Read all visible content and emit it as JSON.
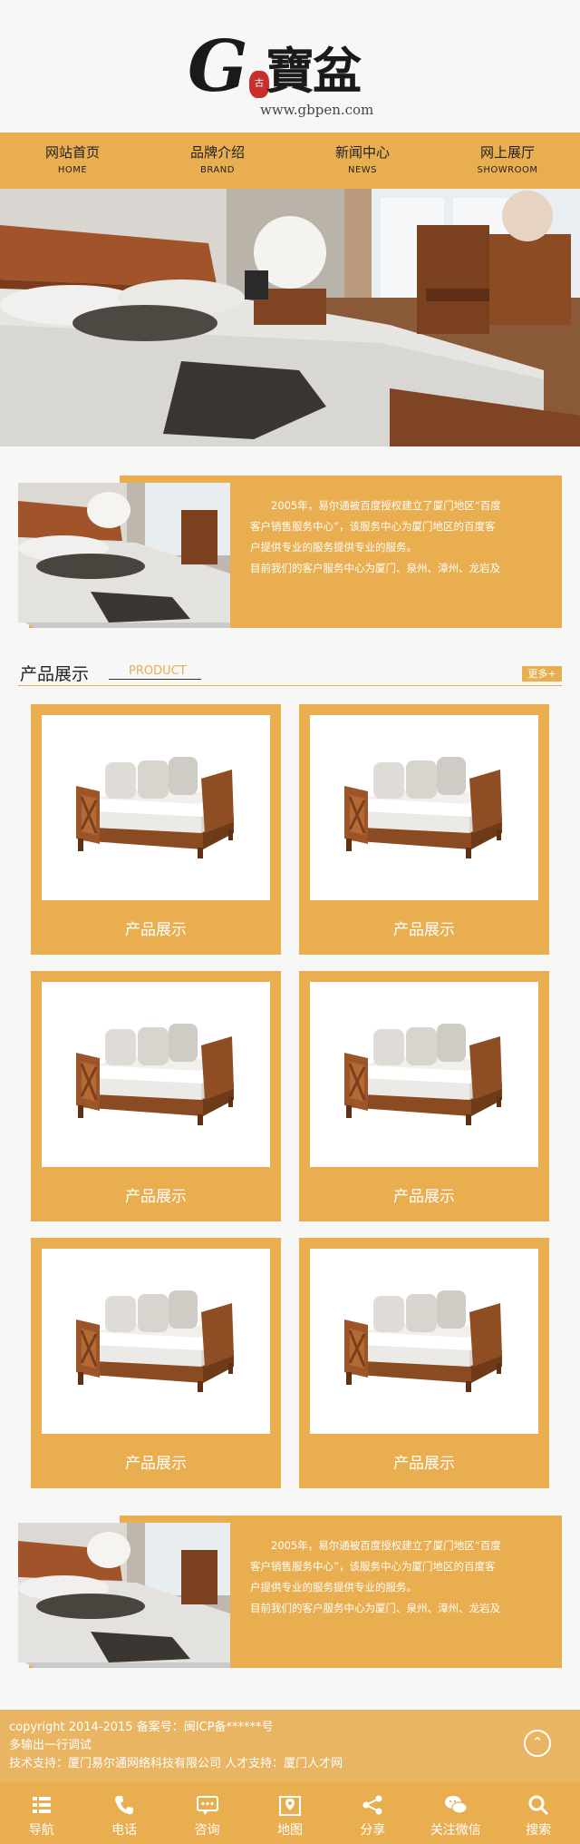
{
  "header": {
    "logo_letter": "G",
    "logo_chinese": "寶盆",
    "logo_seal": "古",
    "site_url": "www.gbpen.com"
  },
  "nav": {
    "items": [
      {
        "cn": "网站首页",
        "en": "HOME"
      },
      {
        "cn": "品牌介绍",
        "en": "BRAND"
      },
      {
        "cn": "新闻中心",
        "en": "NEWS"
      },
      {
        "cn": "网上展厅",
        "en": "SHOWROOM"
      }
    ]
  },
  "about_top": {
    "lines": [
      "2005年，易尔通被百度授权建立了厦门地区“百度",
      "客户销售服务中心”，该服务中心为厦门地区的百度客",
      "户提供专业的服务提供专业的服务。",
      "目前我们的客户服务中心为厦门、泉州、漳州、龙岩及"
    ]
  },
  "products": {
    "title": "产品展示",
    "subtitle": "PRODUCT",
    "more": "更多+",
    "items": [
      {
        "title": "产品展示"
      },
      {
        "title": "产品展示"
      },
      {
        "title": "产品展示"
      },
      {
        "title": "产品展示"
      },
      {
        "title": "产品展示"
      },
      {
        "title": "产品展示"
      }
    ]
  },
  "about_bottom": {
    "lines": [
      "2005年，易尔通被百度授权建立了厦门地区“百度",
      "客户销售服务中心”，该服务中心为厦门地区的百度客",
      "户提供专业的服务提供专业的服务。",
      "目前我们的客户服务中心为厦门、泉州、漳州、龙岩及"
    ]
  },
  "footer": {
    "copyright": "copyright 2014-2015 备案号：闽ICP备******号",
    "line2": "多输出一行调试",
    "line3": "技术支持：厦门易尔通网络科技有限公司 人才支持：厦门人才网",
    "top_icon": "⌃"
  },
  "bottombar": {
    "items": [
      {
        "label": "导航",
        "icon": "menu-icon"
      },
      {
        "label": "电话",
        "icon": "phone-icon"
      },
      {
        "label": "咨询",
        "icon": "chat-icon"
      },
      {
        "label": "地图",
        "icon": "map-icon"
      },
      {
        "label": "分享",
        "icon": "share-icon"
      },
      {
        "label": "关注微信",
        "icon": "wechat-icon"
      },
      {
        "label": "搜索",
        "icon": "search-icon"
      }
    ]
  },
  "colors": {
    "accent": "#e9ae50",
    "footer": "#e9b563",
    "background": "#f7f7f7"
  }
}
